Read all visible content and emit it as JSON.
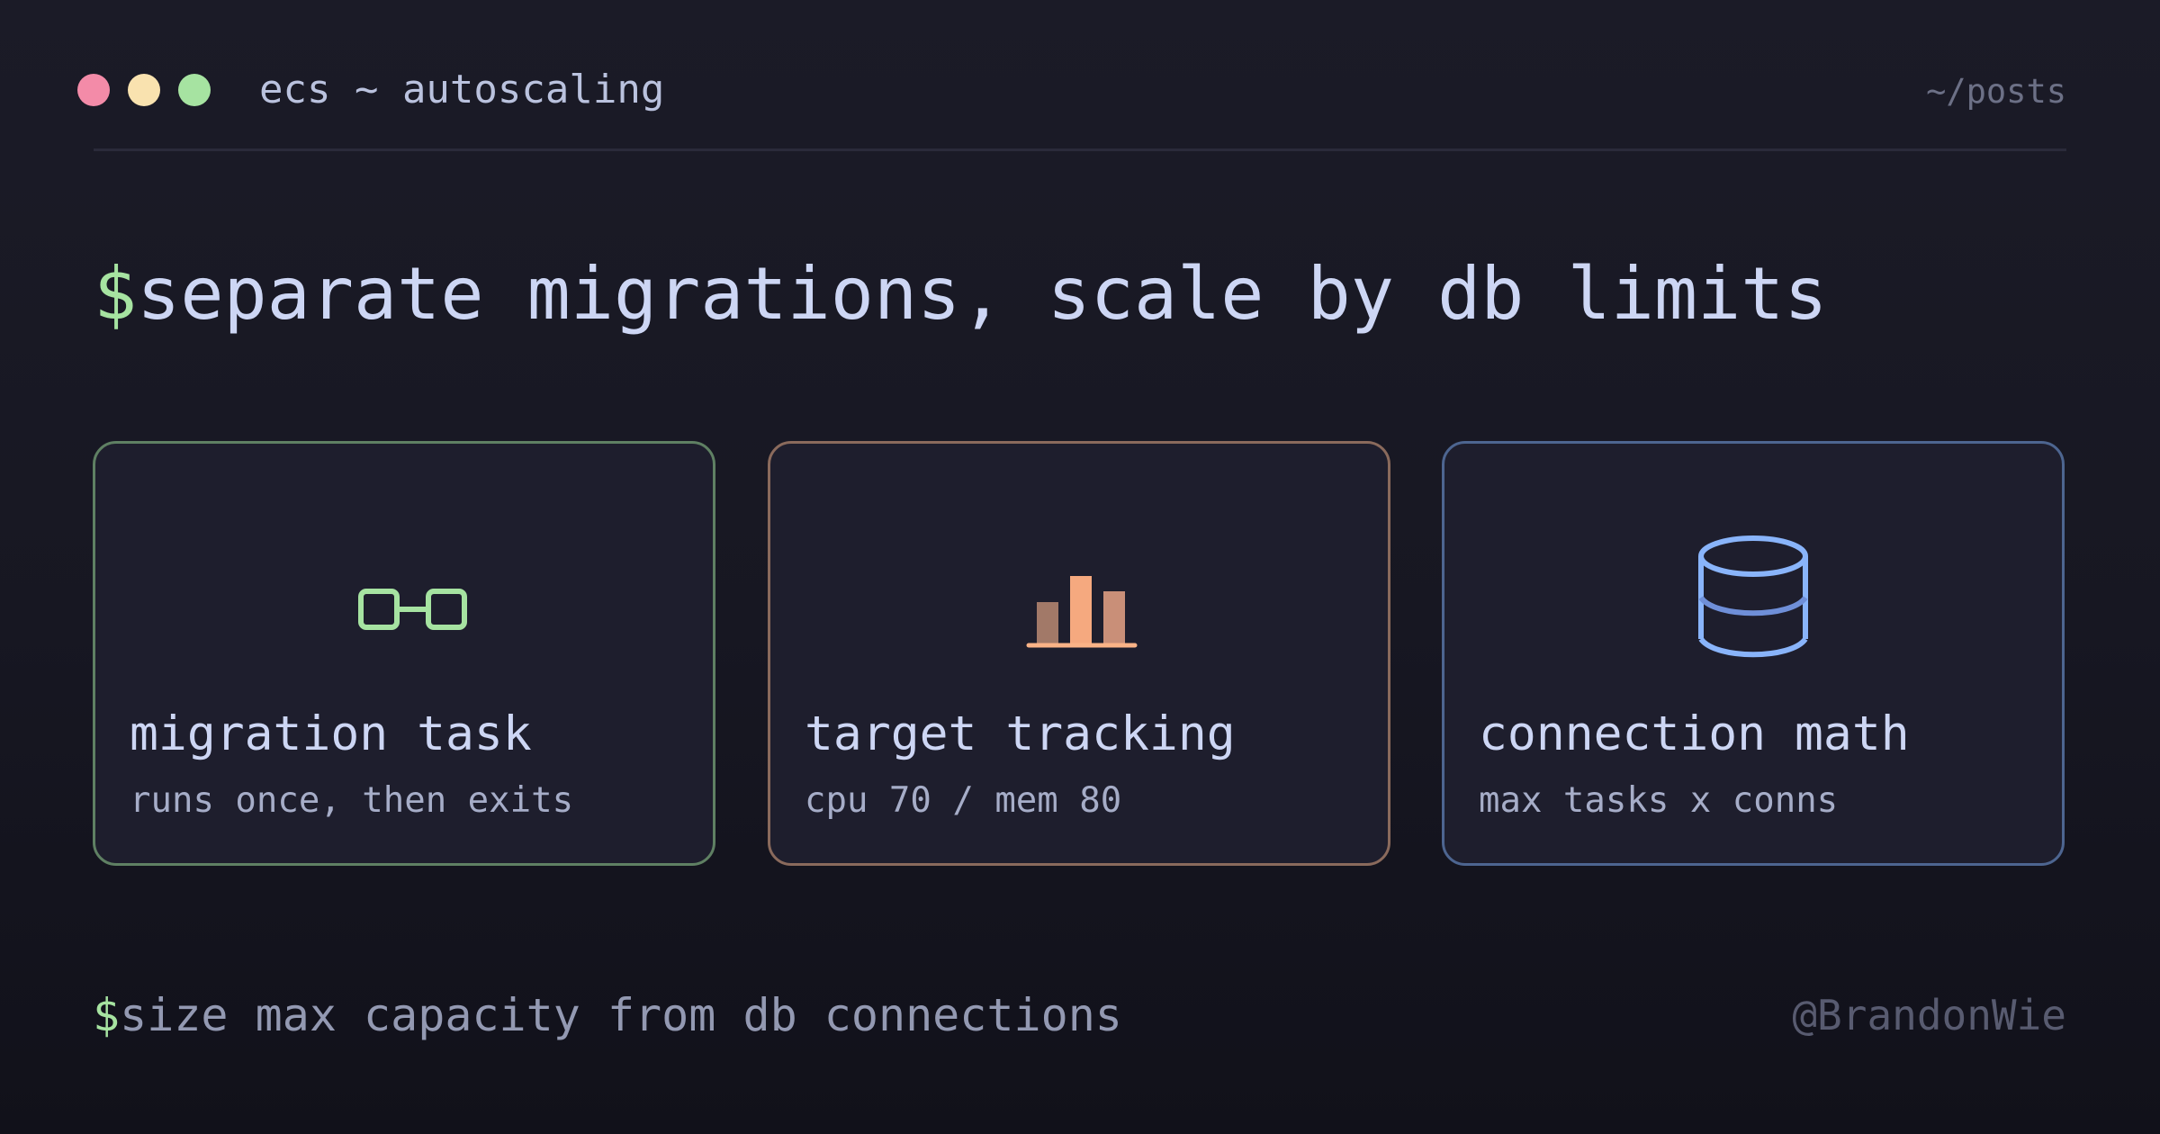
{
  "window": {
    "title": "ecs ~ autoscaling",
    "link": "~/posts",
    "controls": [
      {
        "name": "close",
        "color": "#f38ba8"
      },
      {
        "name": "minimize",
        "color": "#f9e2af"
      },
      {
        "name": "maximize",
        "color": "#a6e3a1"
      }
    ]
  },
  "headline": {
    "prompt": "$",
    "text": "separate migrations, scale by db limits"
  },
  "cards": [
    {
      "icon": "linked-task-icon",
      "title": "migration task",
      "subtitle": "runs once, then exits",
      "accent_color": "#a6e3a1"
    },
    {
      "icon": "bar-chart-icon",
      "title": "target tracking",
      "subtitle": "cpu 70 / mem 80",
      "accent_color": "#fab387"
    },
    {
      "icon": "database-icon",
      "title": "connection math",
      "subtitle": "max tasks x conns",
      "accent_color": "#89b4fa"
    }
  ],
  "footer": {
    "prompt": "$",
    "command": "size max capacity from db connections",
    "handle": "@BrandonWie"
  }
}
